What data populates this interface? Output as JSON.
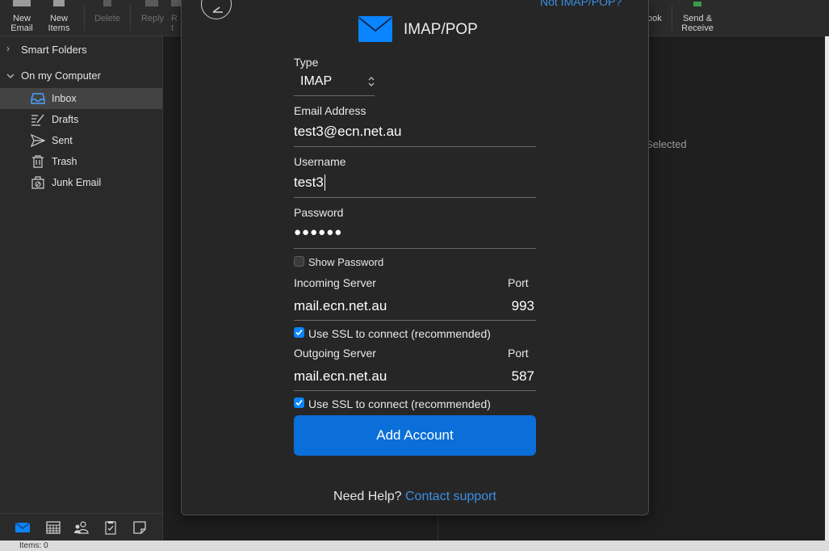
{
  "toolbar": {
    "new_email": "New\nEmail",
    "new_items": "New\nItems",
    "delete": "Delete",
    "reply": "Reply",
    "reply_all_partial": "R\nt",
    "outlook_partial": "ook",
    "send_receive": "Send &\nReceive"
  },
  "sidebar": {
    "smart_folders": "Smart Folders",
    "on_my_computer": "On my Computer",
    "items": [
      {
        "label": "Inbox"
      },
      {
        "label": "Drafts"
      },
      {
        "label": "Sent"
      },
      {
        "label": "Trash"
      },
      {
        "label": "Junk Email"
      }
    ]
  },
  "status_bar": {
    "text": "Items: 0"
  },
  "reading_pane": {
    "no_selection_partial": "Selected"
  },
  "dialog": {
    "not_link": "Not IMAP/POP?",
    "title": "IMAP/POP",
    "type_label": "Type",
    "type_value": "IMAP",
    "email_label": "Email Address",
    "email_value": "test3@ecn.net.au",
    "username_label": "Username",
    "username_value": "test3",
    "password_label": "Password",
    "password_value": "●●●●●●",
    "show_password_label": "Show Password",
    "show_password_checked": false,
    "incoming_label": "Incoming Server",
    "incoming_value": "mail.ecn.net.au",
    "incoming_port_label": "Port",
    "incoming_port_value": "993",
    "incoming_ssl_label": "Use SSL to connect (recommended)",
    "outgoing_label": "Outgoing Server",
    "outgoing_value": "mail.ecn.net.au",
    "outgoing_port_label": "Port",
    "outgoing_port_value": "587",
    "outgoing_ssl_label": "Use SSL to connect (recommended)",
    "add_account": "Add Account",
    "help_text": "Need Help?",
    "help_link": "Contact support"
  },
  "colors": {
    "accent": "#0a84ff",
    "button": "#0a6fd8",
    "link": "#3b8fe8"
  }
}
